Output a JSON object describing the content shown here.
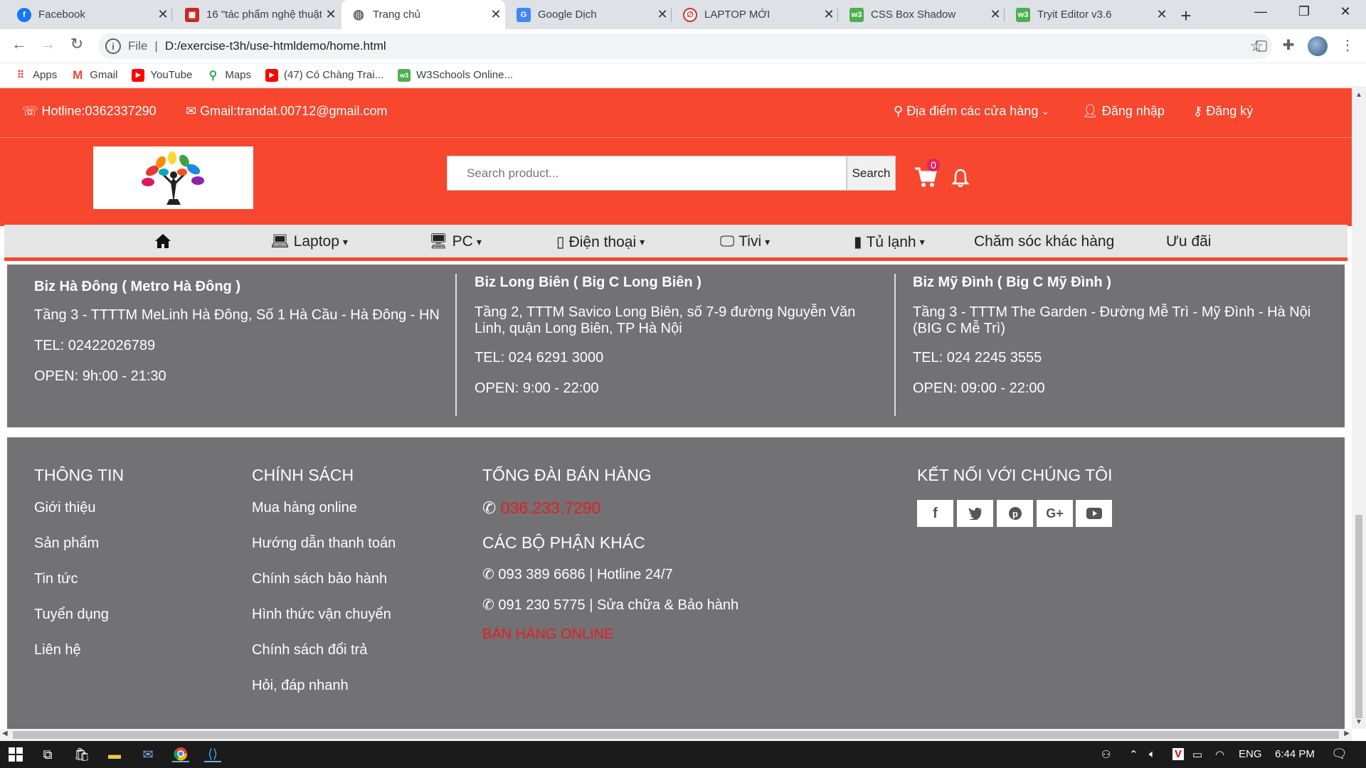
{
  "tabs": [
    {
      "title": "Facebook",
      "icon": "facebook-icon",
      "color": "#1877f2",
      "glyph": "f"
    },
    {
      "title": "16 \"tác phẩm nghệ thuật",
      "icon": "news-icon",
      "color": "#c62828",
      "glyph": "▦"
    },
    {
      "title": "Trang chủ",
      "icon": "globe-icon",
      "color": "#5f6368",
      "glyph": "◍",
      "active": true
    },
    {
      "title": "Google Dịch",
      "icon": "google-translate-icon",
      "color": "#4285f4",
      "glyph": "G"
    },
    {
      "title": "LAPTOP MỚI",
      "icon": "laptop-site-icon",
      "color": "#d32f2f",
      "glyph": "∅"
    },
    {
      "title": "CSS Box Shadow",
      "icon": "w3schools-icon",
      "color": "#4caf50",
      "glyph": "w3"
    },
    {
      "title": "Tryit Editor v3.6",
      "icon": "w3schools-icon",
      "color": "#4caf50",
      "glyph": "w3"
    }
  ],
  "browser": {
    "file_label": "File",
    "url": "D:/exercise-t3h/use-htmldemo/home.html"
  },
  "bookmarks": [
    {
      "label": "Apps",
      "icon": "apps-grid-icon",
      "color": "#ea4335",
      "glyph": "⋮⋮"
    },
    {
      "label": "Gmail",
      "icon": "gmail-icon",
      "color": "#ea4335",
      "glyph": "M"
    },
    {
      "label": "YouTube",
      "icon": "youtube-icon",
      "color": "#ff0000",
      "glyph": "▶"
    },
    {
      "label": "Maps",
      "icon": "maps-icon",
      "color": "#34a853",
      "glyph": "⬤"
    },
    {
      "label": "(47) Có Chàng Trai...",
      "icon": "youtube-icon",
      "color": "#ff0000",
      "glyph": "▶"
    },
    {
      "label": "W3Schools Online...",
      "icon": "w3schools-icon",
      "color": "#4caf50",
      "glyph": "w3"
    }
  ],
  "topbar": {
    "hotline": "Hotline:0362337290",
    "gmail": "Gmail:trandat.00712@gmail.com",
    "stores": "Địa điểm các cửa hàng",
    "login": "Đăng nhập",
    "register": "Đăng ký"
  },
  "search": {
    "placeholder": "Search product...",
    "button": "Search"
  },
  "cart": {
    "count": "0"
  },
  "nav": [
    {
      "label": "",
      "icon": "home-icon"
    },
    {
      "label": "Laptop",
      "icon": "laptop-icon",
      "dropdown": true
    },
    {
      "label": "PC",
      "icon": "desktop-icon",
      "dropdown": true
    },
    {
      "label": "Điện thoại",
      "icon": "mobile-icon",
      "dropdown": true
    },
    {
      "label": "Tivi",
      "icon": "tv-icon",
      "dropdown": true
    },
    {
      "label": "Tủ lạnh",
      "icon": "fridge-icon",
      "dropdown": true
    },
    {
      "label": "Chăm sóc khác hàng",
      "icon": ""
    },
    {
      "label": "Ưu đãi",
      "icon": ""
    }
  ],
  "stores": [
    {
      "name": "Biz Hà Đông ( Metro Hà Đông )",
      "address": "Tầng 3 - TTTTM MeLinh Hà Đông, Số 1 Hà Cầu - Hà Đông - HN",
      "tel": "TEL: 02422026789",
      "open": "OPEN: 9h:00 - 21:30"
    },
    {
      "name": "Biz Long Biên ( Big C Long Biên )",
      "address": "Tầng 2, TTTM Savico Long Biên, số 7-9 đường Nguyễn Văn Linh, quận Long Biên, TP Hà Nội",
      "tel": "TEL: 024 6291 3000",
      "open": "OPEN: 9:00 - 22:00"
    },
    {
      "name": "Biz Mỹ Đình ( Big C Mỹ Đình )",
      "address": "Tầng 3 - TTTM The Garden - Đường Mễ Trì - Mỹ Đình - Hà Nội (BIG C Mễ Trì)",
      "tel": "TEL: 024 2245 3555",
      "open": "OPEN: 09:00 - 22:00"
    }
  ],
  "footer": {
    "info": {
      "title": "THÔNG TIN",
      "links": [
        "Giới thiệu",
        "Sản phẩm",
        "Tin tức",
        "Tuyển dụng",
        "Liên hệ"
      ]
    },
    "policy": {
      "title": "CHÍNH SÁCH",
      "links": [
        "Mua hàng online",
        "Hướng dẫn thanh toán",
        "Chính sách bảo hành",
        "Hình thức vận chuyển",
        "Chính sách đổi trả",
        "Hỏi, đáp nhanh"
      ]
    },
    "sales": {
      "title": "TỔNG ĐÀI BÁN HÀNG",
      "phone": "036.233.7290",
      "other_title": "CÁC BỘ PHẬN KHÁC",
      "line1": "093 389 6686 | Hotline 24/7",
      "line2": "091 230 5775 | Sửa chữa & Bảo hành",
      "online": "BÁN HÀNG ONLINE"
    },
    "connect": {
      "title": "KẾT NỐI VỚI CHÚNG TÔI",
      "socials": [
        "facebook-icon",
        "twitter-icon",
        "pinterest-icon",
        "google-plus-icon",
        "youtube-icon"
      ]
    }
  },
  "taskbar": {
    "lang": "ENG",
    "time": "6:44 PM"
  },
  "colors": {
    "brand_orange": "#f7472e",
    "store_gray": "#727173",
    "accent_red": "#e71c23"
  }
}
